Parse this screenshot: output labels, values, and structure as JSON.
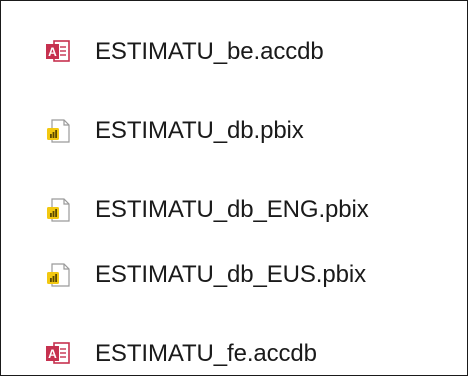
{
  "files": [
    {
      "name": "ESTIMATU_be.accdb",
      "icon": "access-file-icon"
    },
    {
      "name": "ESTIMATU_db.pbix",
      "icon": "powerbi-file-icon"
    },
    {
      "name": "ESTIMATU_db_ENG.pbix",
      "icon": "powerbi-file-icon"
    },
    {
      "name": "ESTIMATU_db_EUS.pbix",
      "icon": "powerbi-file-icon"
    },
    {
      "name": "ESTIMATU_fe.accdb",
      "icon": "access-file-icon"
    }
  ],
  "colors": {
    "access_red": "#c6314f",
    "powerbi_yellow": "#f2c811",
    "text": "#1a1a1a",
    "border": "#1a1a1a"
  }
}
